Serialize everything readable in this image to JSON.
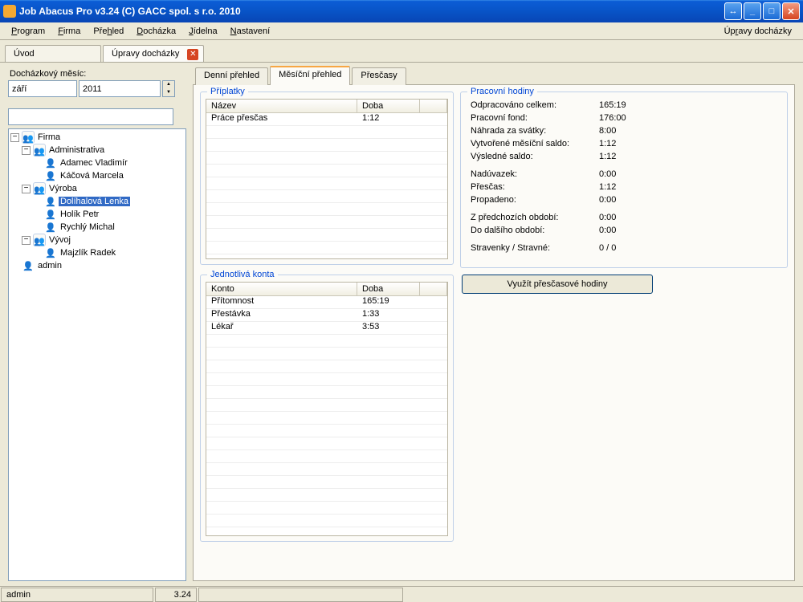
{
  "title": "Job Abacus Pro v3.24 (C) GACC spol. s r.o. 2010",
  "menu": [
    "Program",
    "Firma",
    "Přehled",
    "Docházka",
    "Jídelna",
    "Nastavení"
  ],
  "menu_right": "Úpravy docházky",
  "doctabs": {
    "uvod": "Úvod",
    "upravy": "Úpravy docházky"
  },
  "left": {
    "label": "Docházkový měsíc:",
    "month": "září",
    "year": "2011"
  },
  "tree": {
    "firma": "Firma",
    "admin": "Administrativa",
    "adamec": "Adamec Vladimír",
    "kacova": "Káčová Marcela",
    "vyroba": "Výroba",
    "dolihalova": "Dolíhalová Lenka",
    "holik": "Holík Petr",
    "rychly": "Rychlý Michal",
    "vyvoj": "Vývoj",
    "majzlik": "Majzlík Radek",
    "adminu": "admin"
  },
  "subtabs": {
    "denni": "Denní přehled",
    "mesicni": "Měsíční přehled",
    "prescasy": "Přesčasy"
  },
  "priplatky": {
    "title": "Příplatky",
    "h_nazev": "Název",
    "h_doba": "Doba",
    "rows": [
      {
        "n": "Práce přesčas",
        "d": "1:12"
      }
    ]
  },
  "konta": {
    "title": "Jednotlivá konta",
    "h_konto": "Konto",
    "h_doba": "Doba",
    "rows": [
      {
        "n": "Přítomnost",
        "d": "165:19"
      },
      {
        "n": "Přestávka",
        "d": "1:33"
      },
      {
        "n": "Lékař",
        "d": "3:53"
      }
    ]
  },
  "work": {
    "title": "Pracovní hodiny",
    "rows": [
      {
        "k": "Odpracováno celkem:",
        "v": "165:19"
      },
      {
        "k": "Pracovní fond:",
        "v": "176:00"
      },
      {
        "k": "Náhrada za svátky:",
        "v": "8:00"
      },
      {
        "k": "Vytvořené měsíční saldo:",
        "v": "1:12"
      },
      {
        "k": "Výsledné saldo:",
        "v": "1:12"
      }
    ],
    "rows2": [
      {
        "k": "Nadúvazek:",
        "v": "0:00"
      },
      {
        "k": "Přesčas:",
        "v": "1:12"
      },
      {
        "k": "Propadeno:",
        "v": "0:00"
      }
    ],
    "rows3": [
      {
        "k": "Z předchozích období:",
        "v": "0:00"
      },
      {
        "k": "Do dalšího období:",
        "v": "0:00"
      }
    ],
    "rows4": [
      {
        "k": "Stravenky / Stravné:",
        "v": "0 / 0"
      }
    ]
  },
  "btn_use": "Využít přesčasové hodiny",
  "status": {
    "user": "admin",
    "ver": "3.24"
  }
}
